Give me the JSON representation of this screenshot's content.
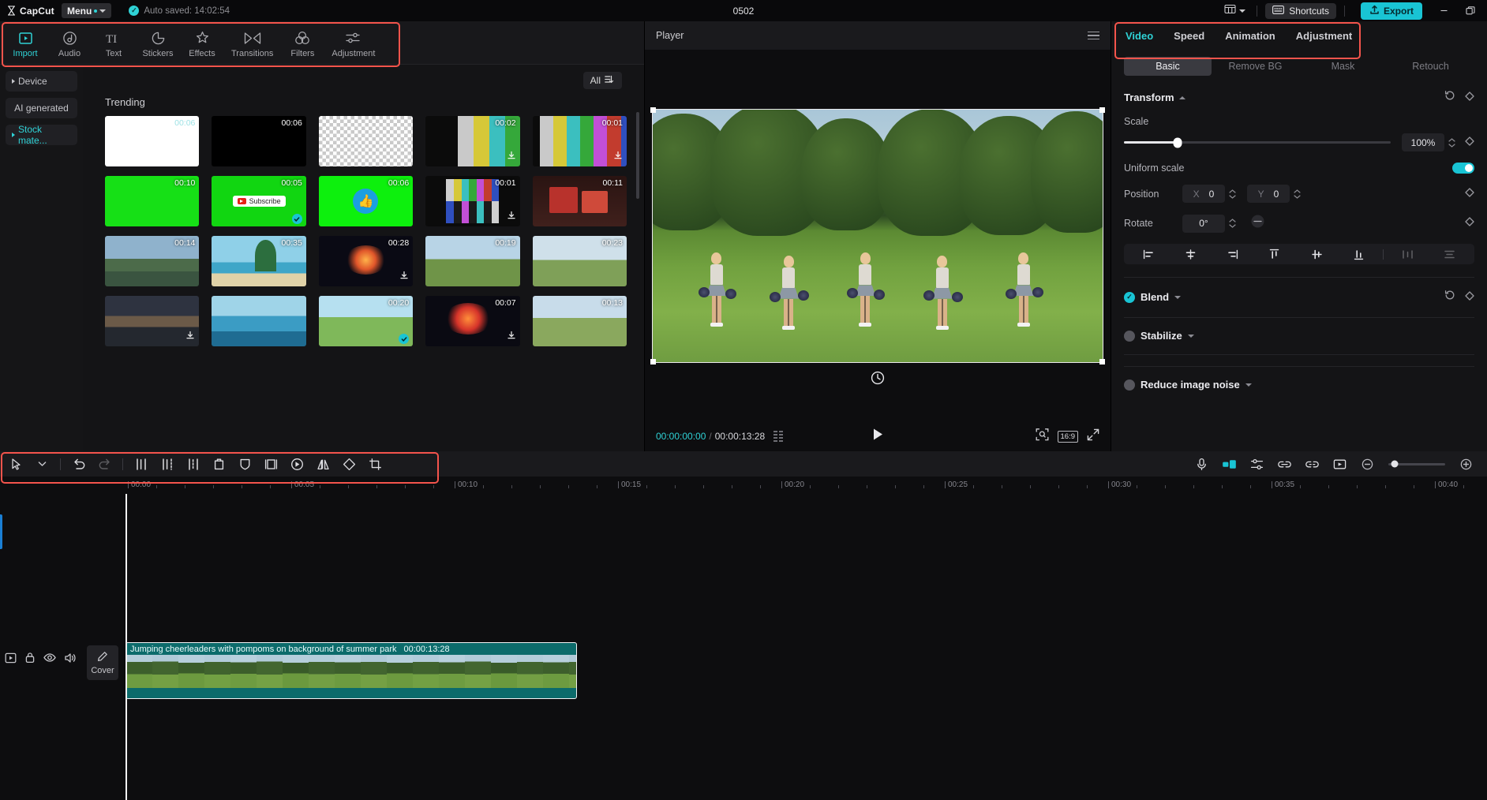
{
  "titlebar": {
    "app_name": "CapCut",
    "menu_label": "Menu",
    "autosave_text": "Auto saved: 14:02:54",
    "project_title": "0502",
    "shortcuts_label": "Shortcuts",
    "export_label": "Export",
    "layout_icon": "layout-icon",
    "minimize_icon": "minimize-icon",
    "restore_icon": "restore-icon"
  },
  "toolbar": {
    "items": [
      {
        "label": "Import",
        "icon": "import-icon",
        "active": true
      },
      {
        "label": "Audio",
        "icon": "audio-icon",
        "active": false
      },
      {
        "label": "Text",
        "icon": "text-icon",
        "active": false
      },
      {
        "label": "Stickers",
        "icon": "stickers-icon",
        "active": false
      },
      {
        "label": "Effects",
        "icon": "effects-icon",
        "active": false
      },
      {
        "label": "Transitions",
        "icon": "transitions-icon",
        "active": false
      },
      {
        "label": "Filters",
        "icon": "filters-icon",
        "active": false
      },
      {
        "label": "Adjustment",
        "icon": "adjustment-icon",
        "active": false
      }
    ]
  },
  "sidebar": {
    "items": [
      {
        "label": "Device",
        "expandable": true,
        "teal": false
      },
      {
        "label": "AI generated",
        "expandable": false,
        "teal": false
      },
      {
        "label": "Stock mate...",
        "expandable": true,
        "teal": true
      }
    ]
  },
  "media": {
    "filter_label": "All",
    "filter_icon": "filter-icon",
    "section_title": "Trending",
    "items": [
      {
        "duration": "00:06",
        "kind": "white",
        "download": false,
        "badge": false
      },
      {
        "duration": "00:06",
        "kind": "black",
        "download": false,
        "badge": false
      },
      {
        "duration": "",
        "kind": "checker",
        "download": false,
        "badge": false
      },
      {
        "duration": "00:02",
        "kind": "bars",
        "download": true,
        "badge": false
      },
      {
        "duration": "00:01",
        "kind": "bars2",
        "download": true,
        "badge": false
      },
      {
        "duration": "00:10",
        "kind": "green",
        "download": false,
        "badge": false
      },
      {
        "duration": "00:05",
        "kind": "subscribe",
        "download": false,
        "badge": true
      },
      {
        "duration": "00:06",
        "kind": "thumbsup",
        "download": false,
        "badge": false
      },
      {
        "duration": "00:01",
        "kind": "testcard",
        "download": true,
        "badge": false
      },
      {
        "duration": "00:11",
        "kind": "gift",
        "download": false,
        "badge": false
      },
      {
        "duration": "00:14",
        "kind": "city",
        "download": false,
        "badge": false
      },
      {
        "duration": "00:35",
        "kind": "beach",
        "download": false,
        "badge": false
      },
      {
        "duration": "00:28",
        "kind": "firework",
        "download": true,
        "badge": false
      },
      {
        "duration": "00:19",
        "kind": "jump",
        "download": false,
        "badge": false
      },
      {
        "duration": "00:23",
        "kind": "friends",
        "download": false,
        "badge": false
      },
      {
        "duration": "",
        "kind": "sunset",
        "download": true,
        "badge": false
      },
      {
        "duration": "",
        "kind": "sea",
        "download": false,
        "badge": false
      },
      {
        "duration": "00:20",
        "kind": "field",
        "download": false,
        "badge": true
      },
      {
        "duration": "00:07",
        "kind": "fw2",
        "download": true,
        "badge": false
      },
      {
        "duration": "00:13",
        "kind": "beachrun",
        "download": false,
        "badge": false
      }
    ]
  },
  "player": {
    "title": "Player",
    "menu_icon": "hamburger-icon",
    "current_time": "00:00:00:00",
    "total_time": "00:00:13:28",
    "separator": "/",
    "frames_icon": "frames-icon",
    "play_icon": "play-icon",
    "fit_icon": "fit-screen-icon",
    "ratio_label": "16:9",
    "fullscreen_icon": "fullscreen-icon",
    "reset_rotation_icon": "reset-rotation-icon"
  },
  "inspector": {
    "tabs": [
      {
        "label": "Video",
        "active": true
      },
      {
        "label": "Speed",
        "active": false
      },
      {
        "label": "Animation",
        "active": false
      },
      {
        "label": "Adjustment",
        "active": false
      }
    ],
    "subtabs": [
      {
        "label": "Basic",
        "active": true
      },
      {
        "label": "Remove BG",
        "active": false
      },
      {
        "label": "Mask",
        "active": false
      },
      {
        "label": "Retouch",
        "active": false
      }
    ],
    "transform": {
      "title": "Transform",
      "reset_icon": "reset-icon",
      "keyframe_icon": "keyframe-icon",
      "scale_label": "Scale",
      "scale_value": "100%",
      "scale_percent": 20,
      "uniform_scale_label": "Uniform scale",
      "uniform_scale_on": true,
      "position_label": "Position",
      "position_x_axis": "X",
      "position_x_value": "0",
      "position_y_axis": "Y",
      "position_y_value": "0",
      "rotate_label": "Rotate",
      "rotate_value": "0°",
      "align_icons": [
        "align-left-icon",
        "align-center-h-icon",
        "align-right-icon",
        "align-top-icon",
        "align-center-v-icon",
        "align-bottom-icon",
        "distribute-h-icon",
        "distribute-v-icon"
      ]
    },
    "blend": {
      "label": "Blend",
      "enabled": true
    },
    "stabilize": {
      "label": "Stabilize",
      "enabled": false
    },
    "reduce_noise": {
      "label": "Reduce image noise",
      "enabled": false
    }
  },
  "timeline": {
    "tools": [
      {
        "icon": "select-cursor-icon",
        "dim": false
      },
      {
        "icon": "chevron-down-icon",
        "dim": false
      },
      {
        "icon": "undo-icon",
        "dim": false
      },
      {
        "icon": "redo-icon",
        "dim": true
      },
      {
        "icon": "split-icon",
        "dim": false
      },
      {
        "icon": "trim-left-icon",
        "dim": false
      },
      {
        "icon": "trim-right-icon",
        "dim": false
      },
      {
        "icon": "delete-icon",
        "dim": false
      },
      {
        "icon": "shield-icon",
        "dim": false
      },
      {
        "icon": "freeze-frame-icon",
        "dim": false
      },
      {
        "icon": "reverse-icon",
        "dim": false
      },
      {
        "icon": "mirror-icon",
        "dim": false
      },
      {
        "icon": "rotate-icon",
        "dim": false
      },
      {
        "icon": "crop-icon",
        "dim": false
      }
    ],
    "right_tools": [
      {
        "icon": "microphone-icon"
      },
      {
        "icon": "auto-caption-icon"
      },
      {
        "icon": "adjust-tracks-icon"
      },
      {
        "icon": "link-icon"
      },
      {
        "icon": "unlink-icon"
      },
      {
        "icon": "preview-icon"
      },
      {
        "icon": "zoom-out-icon"
      }
    ],
    "zoom_in_icon": "zoom-in-icon",
    "ruler_labels": [
      "00:00",
      "00:05",
      "00:10",
      "00:15",
      "00:20",
      "00:25",
      "00:30",
      "00:35",
      "00:40"
    ],
    "track_controls": [
      {
        "icon": "main-track-icon"
      },
      {
        "icon": "lock-icon"
      },
      {
        "icon": "eye-icon"
      },
      {
        "icon": "speaker-icon"
      }
    ],
    "cover_label": "Cover",
    "cover_icon": "pencil-icon",
    "clip": {
      "name": "Jumping cheerleaders with pompoms on background of summer park",
      "duration": "00:00:13:28"
    }
  },
  "colors": {
    "accent": "#2fd2d6",
    "export": "#19c4d4",
    "clip": "#0c6b6b",
    "annotation": "#f4544c"
  }
}
